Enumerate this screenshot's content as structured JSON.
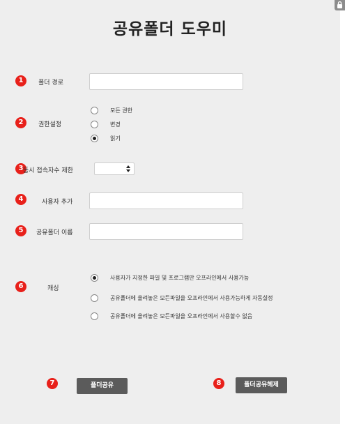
{
  "title": "공유폴더 도우미",
  "steps": [
    "1",
    "2",
    "3",
    "4",
    "5",
    "6",
    "7",
    "8"
  ],
  "folder_path": {
    "label": "폴더 경로",
    "value": ""
  },
  "permission": {
    "label": "권한설정",
    "options": [
      "모든 권한",
      "변경",
      "읽기"
    ],
    "selected": "읽기"
  },
  "concurrent": {
    "label": "동시 접속자수 제한",
    "value": ""
  },
  "add_user": {
    "label": "사용자 추가",
    "value": ""
  },
  "share_name": {
    "label": "공유폴더 이름",
    "value": ""
  },
  "caching": {
    "label": "캐싱",
    "options": [
      "사용자가 지정한 파일 및 프로그램만 오프라인에서 사용가능",
      "공유폴더에 올려놓은 모든파일을 오프라인에서 사용가능하게 자동설정",
      "공유폴더에 올려놓은 모든파일을 오프라인에서 사용할수 없음"
    ],
    "selected": "사용자가 지정한 파일 및 프로그램만 오프라인에서 사용가능"
  },
  "buttons": {
    "share": "폴더공유",
    "unshare": "폴더공유헤제"
  },
  "colors": {
    "badge": "#e8201a",
    "button": "#5b5b5b",
    "panel": "#eeeeee"
  },
  "icons": {
    "corner": "lock-icon",
    "stepper": "up-down-arrows-icon"
  }
}
